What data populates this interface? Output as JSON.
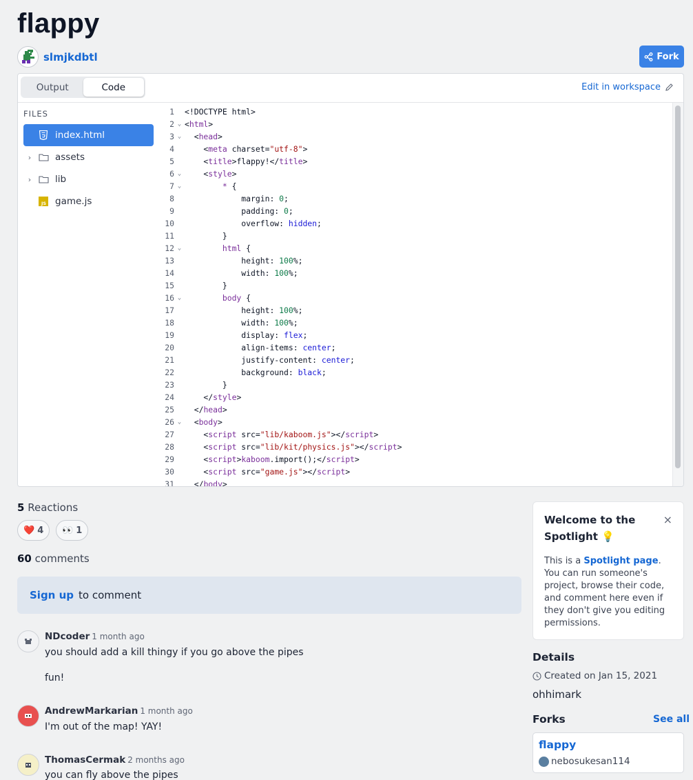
{
  "repl": {
    "title": "flappy",
    "owner": "slmjkdbtl",
    "fork_label": "Fork"
  },
  "tabs": {
    "output": "Output",
    "code": "Code",
    "active": "Code"
  },
  "edit_link": "Edit in workspace",
  "files": {
    "heading": "FILES",
    "items": [
      {
        "name": "index.html",
        "type": "html",
        "active": true
      },
      {
        "name": "assets",
        "type": "folder"
      },
      {
        "name": "lib",
        "type": "folder"
      },
      {
        "name": "game.js",
        "type": "js"
      }
    ]
  },
  "code_lines": [
    {
      "n": "1",
      "fold": false
    },
    {
      "n": "2",
      "fold": true
    },
    {
      "n": "3",
      "fold": true
    },
    {
      "n": "4",
      "fold": false
    },
    {
      "n": "5",
      "fold": false
    },
    {
      "n": "6",
      "fold": true
    },
    {
      "n": "7",
      "fold": true
    },
    {
      "n": "8",
      "fold": false
    },
    {
      "n": "9",
      "fold": false
    },
    {
      "n": "10",
      "fold": false
    },
    {
      "n": "11",
      "fold": false
    },
    {
      "n": "12",
      "fold": true
    },
    {
      "n": "13",
      "fold": false
    },
    {
      "n": "14",
      "fold": false
    },
    {
      "n": "15",
      "fold": false
    },
    {
      "n": "16",
      "fold": true
    },
    {
      "n": "17",
      "fold": false
    },
    {
      "n": "18",
      "fold": false
    },
    {
      "n": "19",
      "fold": false
    },
    {
      "n": "20",
      "fold": false
    },
    {
      "n": "21",
      "fold": false
    },
    {
      "n": "22",
      "fold": false
    },
    {
      "n": "23",
      "fold": false
    },
    {
      "n": "24",
      "fold": false
    },
    {
      "n": "25",
      "fold": false
    },
    {
      "n": "26",
      "fold": true
    },
    {
      "n": "27",
      "fold": false
    },
    {
      "n": "28",
      "fold": false
    },
    {
      "n": "29",
      "fold": false
    },
    {
      "n": "30",
      "fold": false
    },
    {
      "n": "31",
      "fold": false
    }
  ],
  "code_text": [
    [
      [
        "ct",
        "<!DOCTYPE html>"
      ]
    ],
    [
      [
        "ct",
        "<"
      ],
      [
        "tg",
        "html"
      ],
      [
        "ct",
        ">"
      ]
    ],
    [
      [
        "ct",
        "  <"
      ],
      [
        "tg",
        "head"
      ],
      [
        "ct",
        ">"
      ]
    ],
    [
      [
        "ct",
        "    <"
      ],
      [
        "tg",
        "meta"
      ],
      [
        "at",
        " charset="
      ],
      [
        "st",
        "\"utf-8\""
      ],
      [
        "ct",
        ">"
      ]
    ],
    [
      [
        "ct",
        "    <"
      ],
      [
        "tg",
        "title"
      ],
      [
        "ct",
        ">flappy!</"
      ],
      [
        "tg",
        "title"
      ],
      [
        "ct",
        ">"
      ]
    ],
    [
      [
        "ct",
        "    <"
      ],
      [
        "tg",
        "style"
      ],
      [
        "ct",
        ">"
      ]
    ],
    [
      [
        "tg",
        "        * "
      ],
      [
        "ct",
        "{"
      ]
    ],
    [
      [
        "ct",
        "            margin: "
      ],
      [
        "nm",
        "0"
      ],
      [
        "ct",
        ";"
      ]
    ],
    [
      [
        "ct",
        "            padding: "
      ],
      [
        "nm",
        "0"
      ],
      [
        "ct",
        ";"
      ]
    ],
    [
      [
        "ct",
        "            overflow: "
      ],
      [
        "kw",
        "hidden"
      ],
      [
        "ct",
        ";"
      ]
    ],
    [
      [
        "ct",
        "        }"
      ]
    ],
    [
      [
        "tg",
        "        html "
      ],
      [
        "ct",
        "{"
      ]
    ],
    [
      [
        "ct",
        "            height: "
      ],
      [
        "nm",
        "100"
      ],
      [
        "ct",
        "%;"
      ]
    ],
    [
      [
        "ct",
        "            width: "
      ],
      [
        "nm",
        "100"
      ],
      [
        "ct",
        "%;"
      ]
    ],
    [
      [
        "ct",
        "        }"
      ]
    ],
    [
      [
        "tg",
        "        body "
      ],
      [
        "ct",
        "{"
      ]
    ],
    [
      [
        "ct",
        "            height: "
      ],
      [
        "nm",
        "100"
      ],
      [
        "ct",
        "%;"
      ]
    ],
    [
      [
        "ct",
        "            width: "
      ],
      [
        "nm",
        "100"
      ],
      [
        "ct",
        "%;"
      ]
    ],
    [
      [
        "ct",
        "            display: "
      ],
      [
        "kw",
        "flex"
      ],
      [
        "ct",
        ";"
      ]
    ],
    [
      [
        "ct",
        "            align-items: "
      ],
      [
        "kw",
        "center"
      ],
      [
        "ct",
        ";"
      ]
    ],
    [
      [
        "ct",
        "            justify-content: "
      ],
      [
        "kw",
        "center"
      ],
      [
        "ct",
        ";"
      ]
    ],
    [
      [
        "ct",
        "            background: "
      ],
      [
        "kw",
        "black"
      ],
      [
        "ct",
        ";"
      ]
    ],
    [
      [
        "ct",
        "        }"
      ]
    ],
    [
      [
        "ct",
        "    </"
      ],
      [
        "tg",
        "style"
      ],
      [
        "ct",
        ">"
      ]
    ],
    [
      [
        "ct",
        "  </"
      ],
      [
        "tg",
        "head"
      ],
      [
        "ct",
        ">"
      ]
    ],
    [
      [
        "ct",
        "  <"
      ],
      [
        "tg",
        "body"
      ],
      [
        "ct",
        ">"
      ]
    ],
    [
      [
        "ct",
        "    <"
      ],
      [
        "tg",
        "script"
      ],
      [
        "at",
        " src="
      ],
      [
        "st",
        "\"lib/kaboom.js\""
      ],
      [
        "ct",
        "></"
      ],
      [
        "tg",
        "script"
      ],
      [
        "ct",
        ">"
      ]
    ],
    [
      [
        "ct",
        "    <"
      ],
      [
        "tg",
        "script"
      ],
      [
        "at",
        " src="
      ],
      [
        "st",
        "\"lib/kit/physics.js\""
      ],
      [
        "ct",
        "></"
      ],
      [
        "tg",
        "script"
      ],
      [
        "ct",
        ">"
      ]
    ],
    [
      [
        "ct",
        "    <"
      ],
      [
        "tg",
        "script"
      ],
      [
        "ct",
        ">"
      ],
      [
        "tg",
        "kaboom"
      ],
      [
        "ct",
        ".import();</"
      ],
      [
        "tg",
        "script"
      ],
      [
        "ct",
        ">"
      ]
    ],
    [
      [
        "ct",
        "    <"
      ],
      [
        "tg",
        "script"
      ],
      [
        "at",
        " src="
      ],
      [
        "st",
        "\"game.js\""
      ],
      [
        "ct",
        "></"
      ],
      [
        "tg",
        "script"
      ],
      [
        "ct",
        ">"
      ]
    ],
    [
      [
        "ct",
        "  </"
      ],
      [
        "tg",
        "body"
      ],
      [
        "ct",
        ">"
      ]
    ]
  ],
  "reactions": {
    "count": "5",
    "label": "Reactions",
    "items": [
      {
        "emoji": "❤️",
        "count": "4"
      },
      {
        "emoji": "👀",
        "count": "1"
      }
    ]
  },
  "comments": {
    "count": "60",
    "label": "comments",
    "signup_link": "Sign up",
    "signup_text": "to comment",
    "items": [
      {
        "author": "NDcoder",
        "time": "1 month ago",
        "lines": [
          "you should add a kill thingy if you go above the pipes",
          "fun!"
        ],
        "avatar_color": "#f2f3f5"
      },
      {
        "author": "AndrewMarkarian",
        "time": "1 month ago",
        "lines": [
          "I'm out of the map! YAY!"
        ],
        "avatar_color": "#e8504f"
      },
      {
        "author": "ThomasCermak",
        "time": "2 months ago",
        "lines": [
          "you can fly above the pipes"
        ],
        "avatar_color": "#f5f0c8"
      }
    ]
  },
  "spotlight": {
    "title": "Welcome to the Spotlight",
    "bulb": "💡",
    "close": "×",
    "body_pre": "This is a ",
    "body_link": "Spotlight page",
    "body_post": ". You can run someone's project, browse their code, and comment here even if they don't give you editing permissions."
  },
  "details": {
    "heading": "Details",
    "created": "Created on Jan 15, 2021",
    "user": "ohhimark"
  },
  "forks": {
    "heading": "Forks",
    "see_all": "See all",
    "items": [
      {
        "name": "flappy",
        "owner": "nebosukesan114"
      }
    ]
  },
  "colors": {
    "accent": "#3a82e6",
    "link": "#1567d3",
    "background": "#f0f1f2"
  }
}
